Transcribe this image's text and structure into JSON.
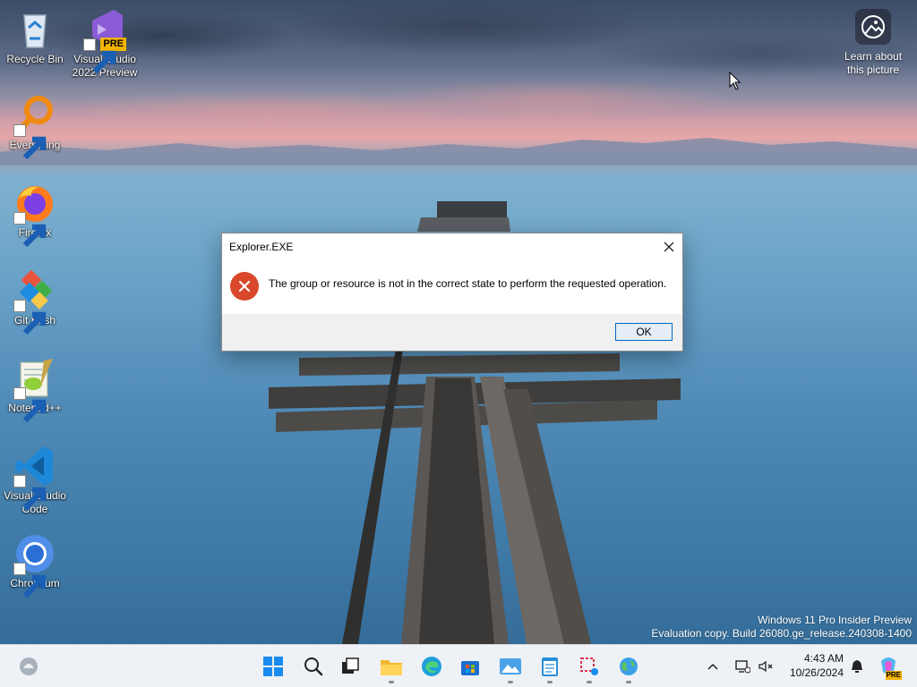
{
  "desktop": {
    "icons": [
      {
        "label": "Recycle Bin",
        "icon": "recycle-bin-icon"
      },
      {
        "label": "Visual Studio 2022 Preview",
        "icon": "visual-studio-icon",
        "badge": "PRE"
      },
      {
        "label": "Everything",
        "icon": "everything-search-icon"
      },
      {
        "label": "Firefox",
        "icon": "firefox-icon"
      },
      {
        "label": "Git Bash",
        "icon": "git-bash-icon"
      },
      {
        "label": "Notepad++",
        "icon": "notepad-plus-plus-icon"
      },
      {
        "label": "Visual Studio Code",
        "icon": "vscode-icon"
      },
      {
        "label": "Chromium",
        "icon": "chromium-icon"
      }
    ],
    "learn_about": {
      "line1": "Learn about",
      "line2": "this picture"
    },
    "watermark": {
      "line1": "Windows 11 Pro Insider Preview",
      "line2": "Evaluation copy. Build 26080.ge_release.240308-1400"
    }
  },
  "dialog": {
    "title": "Explorer.EXE",
    "message": "The group or resource is not in the correct state to perform the requested operation.",
    "ok_label": "OK",
    "icon": "error-icon",
    "close_icon": "close-icon"
  },
  "taskbar": {
    "apps": [
      "widgets-icon",
      "start-icon",
      "search-icon",
      "task-view-icon",
      "file-explorer-icon",
      "edge-icon",
      "store-icon",
      "photos-icon",
      "notepad-icon",
      "snipping-tool-icon",
      "globe-app-icon"
    ],
    "time": "4:43 AM",
    "date": "10/26/2024",
    "copilot_badge": "PRE"
  },
  "colors": {
    "error_red": "#d9482a",
    "accent_blue": "#0067c0",
    "taskbar_bg": "#eef1f6"
  }
}
